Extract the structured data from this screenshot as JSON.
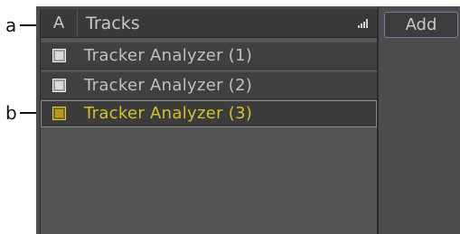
{
  "callouts": {
    "a": "a",
    "b": "b"
  },
  "tracks_panel": {
    "header_column": "A",
    "header_title": "Tracks",
    "rows": [
      {
        "label": "Tracker Analyzer (1)",
        "checkbox_color": "#d9d9d9",
        "selected": false
      },
      {
        "label": "Tracker Analyzer (2)",
        "checkbox_color": "#d9d9d9",
        "selected": false
      },
      {
        "label": "Tracker Analyzer (3)",
        "checkbox_color": "#b59a23",
        "selected": true
      }
    ],
    "selected_label_color": "#d7c12a"
  },
  "toolbar": {
    "add_label": "Add"
  }
}
